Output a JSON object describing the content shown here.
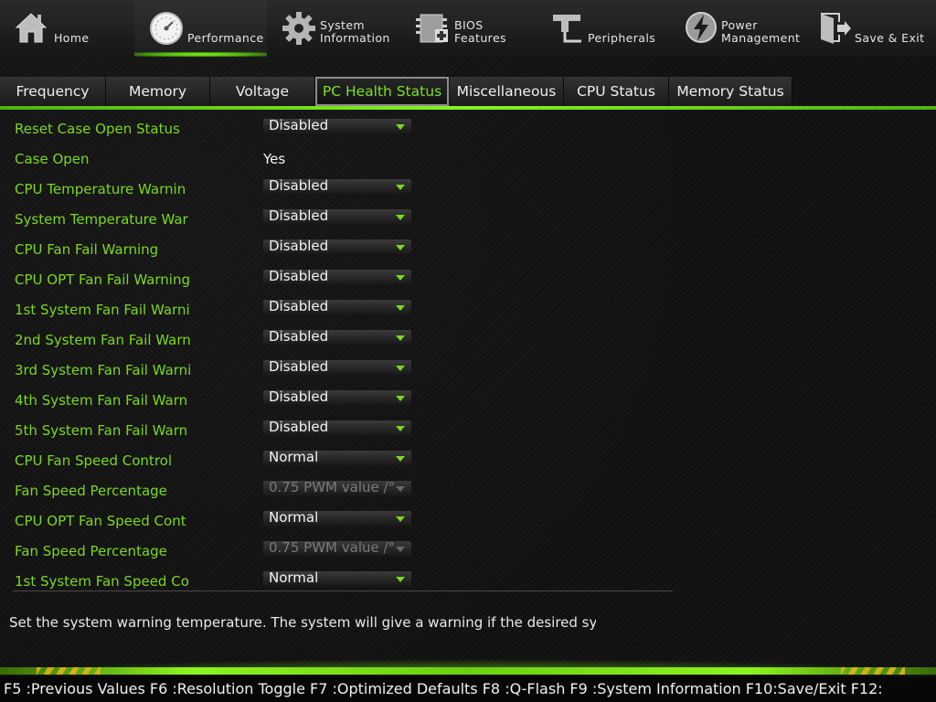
{
  "topnav": {
    "items": [
      {
        "label": "Home",
        "icon": "home-icon"
      },
      {
        "label": "Performance",
        "icon": "gauge-icon"
      },
      {
        "label": "System\nInformation",
        "label_line1": "System",
        "label_line2": "Information",
        "icon": "gear-icon"
      },
      {
        "label": "BIOS\nFeatures",
        "label_line1": "BIOS",
        "label_line2": "Features",
        "icon": "bios-chip-icon"
      },
      {
        "label": "Peripherals",
        "icon": "peripherals-icon"
      },
      {
        "label": "Power\nManagement",
        "label_line1": "Power",
        "label_line2": "Management",
        "icon": "power-icon"
      },
      {
        "label": "Save & Exit",
        "icon": "exit-icon"
      }
    ],
    "active": "Performance"
  },
  "tabs": {
    "items": [
      "Frequency",
      "Memory",
      "Voltage",
      "PC Health Status",
      "Miscellaneous",
      "CPU Status",
      "Memory Status"
    ],
    "active": "PC Health Status"
  },
  "settings": [
    {
      "label": "Reset Case Open Status",
      "value": "Disabled",
      "type": "select"
    },
    {
      "label": "Case Open",
      "value": "Yes",
      "type": "text"
    },
    {
      "label": "CPU Temperature Warnin",
      "value": "Disabled",
      "type": "select"
    },
    {
      "label": "System Temperature War",
      "value": "Disabled",
      "type": "select"
    },
    {
      "label": "CPU Fan Fail Warning",
      "value": "Disabled",
      "type": "select"
    },
    {
      "label": "CPU OPT Fan Fail Warning",
      "value": "Disabled",
      "type": "select"
    },
    {
      "label": "1st System Fan Fail Warni",
      "value": "Disabled",
      "type": "select"
    },
    {
      "label": "2nd System Fan Fail Warn",
      "value": "Disabled",
      "type": "select"
    },
    {
      "label": "3rd System Fan Fail Warni",
      "value": "Disabled",
      "type": "select"
    },
    {
      "label": "4th System Fan Fail Warn",
      "value": "Disabled",
      "type": "select"
    },
    {
      "label": "5th System Fan Fail Warn",
      "value": "Disabled",
      "type": "select"
    },
    {
      "label": "CPU Fan Speed Control",
      "value": "Normal",
      "type": "select"
    },
    {
      "label": "Fan Speed Percentage",
      "value": "0.75 PWM value /°",
      "type": "select-disabled"
    },
    {
      "label": "CPU OPT Fan Speed Cont",
      "value": "Normal",
      "type": "select"
    },
    {
      "label": "Fan Speed Percentage",
      "value": "0.75 PWM value /°",
      "type": "select-disabled"
    },
    {
      "label": "1st System Fan Speed Co",
      "value": "Normal",
      "type": "select"
    }
  ],
  "help": "Set the system warning temperature. The system will  give a warning if the desired sy",
  "footer": "F5 :Previous Values F6 :Resolution Toggle F7 :Optimized Defaults F8 :Q-Flash F9 :System Information F10:Save/Exit F12:",
  "colors": {
    "accent": "#7ad81e",
    "background": "#101010",
    "highlight": "#8df51e"
  }
}
